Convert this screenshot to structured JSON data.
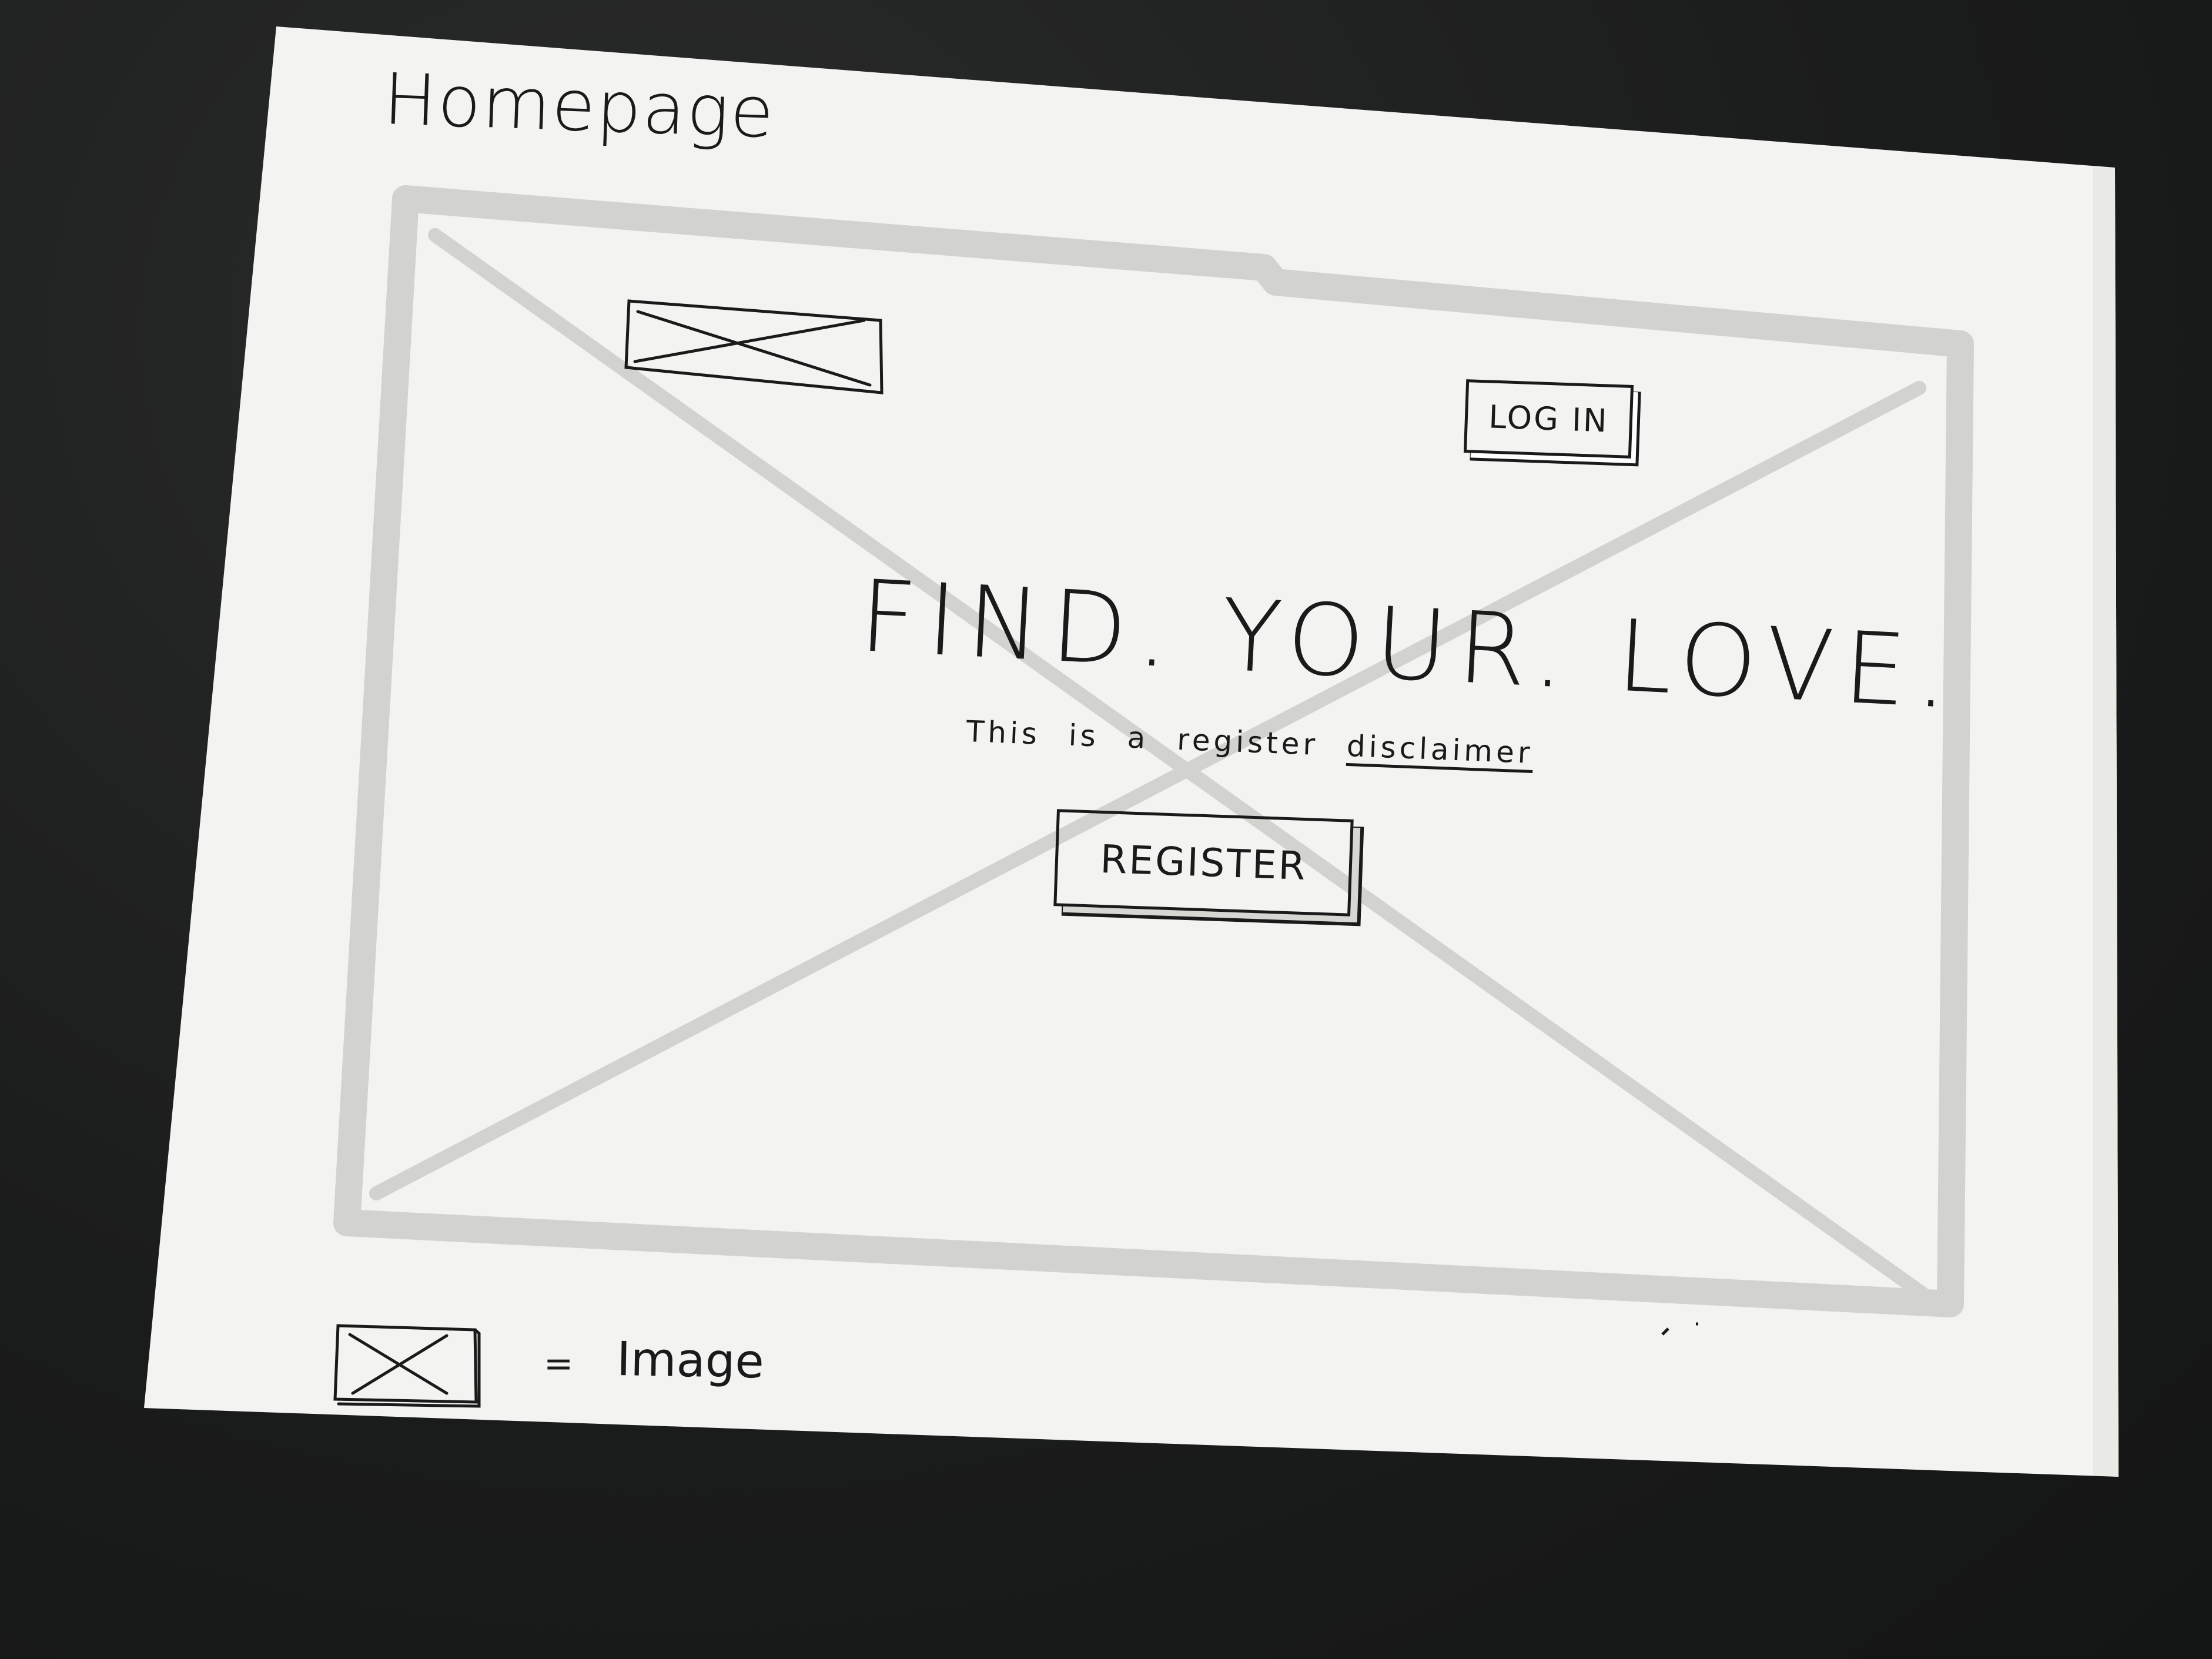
{
  "page_title": "Homepage",
  "header": {
    "login_label": "LOG IN"
  },
  "hero": {
    "headline": "FIND. YOUR. LOVE.",
    "disclaimer_words": [
      "This",
      "is",
      "a",
      "register"
    ],
    "disclaimer_link": "disclaimer",
    "register_label": "REGISTER"
  },
  "legend": {
    "equals": "=",
    "label": "Image"
  },
  "colors": {
    "paper": "#f3f3f1",
    "marker_gray": "#d4d4d0",
    "ink": "#1a1a1a",
    "background": "#1c1d1d"
  },
  "icons": {
    "logo_placeholder": "image-placeholder-icon",
    "hero_background": "image-placeholder-icon",
    "legend_symbol": "image-placeholder-icon"
  }
}
